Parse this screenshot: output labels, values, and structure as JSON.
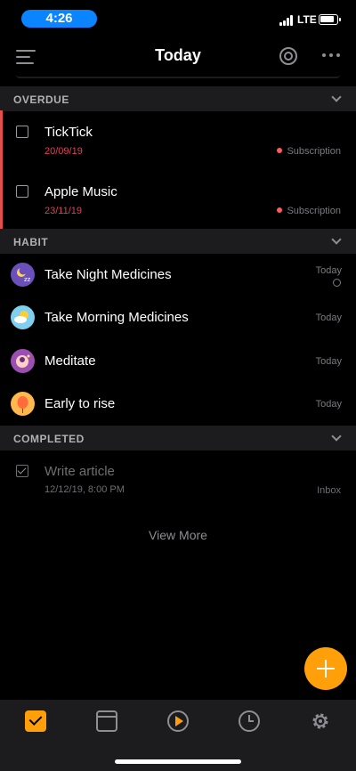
{
  "status": {
    "time": "4:26",
    "network": "LTE"
  },
  "header": {
    "title": "Today"
  },
  "sections": {
    "overdue": {
      "label": "OVERDUE",
      "items": [
        {
          "title": "TickTick",
          "date": "20/09/19",
          "list": "Subscription"
        },
        {
          "title": "Apple Music",
          "date": "23/11/19",
          "list": "Subscription"
        }
      ]
    },
    "habit": {
      "label": "HABIT",
      "items": [
        {
          "title": "Take Night Medicines",
          "when": "Today",
          "icon": "night-moon-icon"
        },
        {
          "title": "Take Morning Medicines",
          "when": "Today",
          "icon": "sun-cloud-icon"
        },
        {
          "title": "Meditate",
          "when": "Today",
          "icon": "meditate-icon"
        },
        {
          "title": "Early to rise",
          "when": "Today",
          "icon": "balloon-icon"
        }
      ]
    },
    "completed": {
      "label": "COMPLETED",
      "items": [
        {
          "title": "Write article",
          "date": "12/12/19, 8:00 PM",
          "list": "Inbox"
        }
      ]
    }
  },
  "view_more": "View More",
  "colors": {
    "accent": "#ff9f0a",
    "overdue": "#e74c4c",
    "date_red": "#e0405a",
    "status_pill": "#0a84ff"
  }
}
